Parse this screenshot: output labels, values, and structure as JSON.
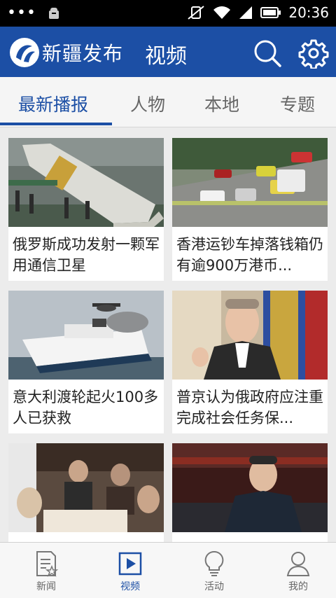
{
  "status_bar": {
    "time": "20:36"
  },
  "header": {
    "app_name": "新疆发布",
    "section_title": "视频"
  },
  "tabs": [
    {
      "label": "最新播报",
      "active": true
    },
    {
      "label": "人物",
      "active": false
    },
    {
      "label": "本地",
      "active": false
    },
    {
      "label": "专题",
      "active": false
    }
  ],
  "videos": [
    {
      "caption": "俄罗斯成功发射一颗军用通信卫星"
    },
    {
      "caption": "香港运钞车掉落钱箱仍有逾900万港币..."
    },
    {
      "caption": "意大利渡轮起火100多人已获救"
    },
    {
      "caption": "普京认为俄政府应注重完成社会任务保..."
    },
    {
      "caption": ""
    },
    {
      "caption": ""
    }
  ],
  "bottom_nav": [
    {
      "label": "新闻",
      "icon": "news-icon",
      "active": false
    },
    {
      "label": "视频",
      "icon": "video-play-icon",
      "active": true
    },
    {
      "label": "活动",
      "icon": "lightbulb-icon",
      "active": false
    },
    {
      "label": "我的",
      "icon": "user-icon",
      "active": false
    }
  ],
  "colors": {
    "brand": "#1c4fa5",
    "status_bar": "#000000",
    "background": "#ececec"
  }
}
